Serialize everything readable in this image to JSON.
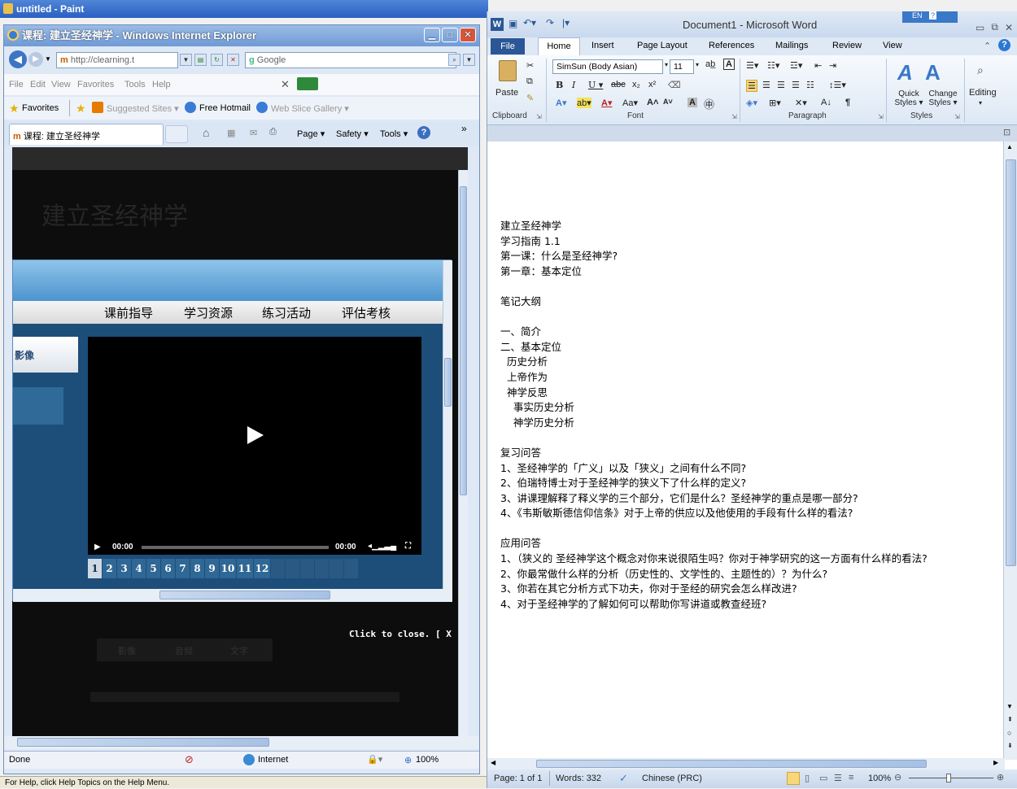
{
  "paint": {
    "title": "untitled - Paint",
    "status": "For Help, click Help Topics on the Help Menu."
  },
  "ie": {
    "title": "课程: 建立圣经神学 - Windows Internet Explorer",
    "address": "http://clearning.t",
    "search_placeholder": "Google",
    "menu": [
      "File",
      "Edit",
      "View",
      "Favorites",
      "Tools",
      "Help"
    ],
    "favorites_label": "Favorites",
    "fav_links": [
      "Suggested Sites ▾",
      "Free Hotmail",
      "Web Slice Gallery ▾"
    ],
    "tab_label": "课程: 建立圣经神学",
    "toolbar": [
      "Page ▾",
      "Safety ▾",
      "Tools ▾"
    ],
    "page_heading": "建立圣经神学",
    "popup_nav": [
      "课前指导",
      "学习资源",
      "练习活动",
      "评估考核"
    ],
    "side_label": "影像",
    "video_time_start": "00:00",
    "video_time_end": "00:00",
    "video_progress": 0,
    "pages": [
      "1",
      "2",
      "3",
      "4",
      "5",
      "6",
      "7",
      "8",
      "9",
      "10",
      "11",
      "12"
    ],
    "click_close": "Click to close. [ X ]",
    "dim_tabs": [
      "影像",
      "音频",
      "文字"
    ],
    "dim_number": "2",
    "status_left": "Done",
    "status_zone": "Internet",
    "status_zoom": "100%"
  },
  "word": {
    "title": "Document1 - Microsoft Word",
    "lang_indicator": "EN",
    "tabs": [
      "File",
      "Home",
      "Insert",
      "Page Layout",
      "References",
      "Mailings",
      "Review",
      "View"
    ],
    "ribbon": {
      "paste": "Paste",
      "font_name": "SimSun (Body Asian)",
      "font_size": "11",
      "quick_styles": "Quick Styles ▾",
      "change_styles": "Change Styles ▾",
      "editing": "Editing",
      "groups": [
        "Clipboard",
        "Font",
        "Paragraph",
        "Styles"
      ]
    },
    "document_lines": [
      "建立圣经神学",
      "学习指南 1.1",
      "第一课：什么是圣经神学?",
      "第一章：基本定位",
      "",
      "笔记大纲",
      "",
      "一、简介",
      "二、基本定位",
      "  历史分析",
      "  上帝作为",
      "  神学反思",
      "    事实历史分析",
      "    神学历史分析",
      "",
      "复习问答",
      "1、圣经神学的「广义」以及「狭义」之间有什么不同?",
      "2、伯瑞特博士对于圣经神学的狭义下了什么样的定义?",
      "3、讲课理解释了释义学的三个部分，它们是什么？圣经神学的重点是哪一部分?",
      "4、《韦斯敏斯德信仰信条》对于上帝的供应以及他使用的手段有什么样的看法?",
      "",
      "应用问答",
      "1、（狭义的 圣经神学这个概念对你来说很陌生吗？你对于神学研究的这一方面有什么样的看法?",
      "2、你最常做什么样的分析（历史性的、文学性的、主题性的）？为什么?",
      "3、你若在其它分析方式下功夫，你对于圣经的研究会怎么样改进?",
      "4、对于圣经神学的了解如何可以帮助你写讲道或教查经班?"
    ],
    "status": {
      "page": "Page: 1 of 1",
      "words": "Words: 332",
      "language": "Chinese (PRC)",
      "zoom": "100%"
    }
  },
  "colors": {
    "ie_popup_bg": "#1d4e7a",
    "word_ribbon": "#dde8f5",
    "accent_blue": "#2a5fc2"
  }
}
